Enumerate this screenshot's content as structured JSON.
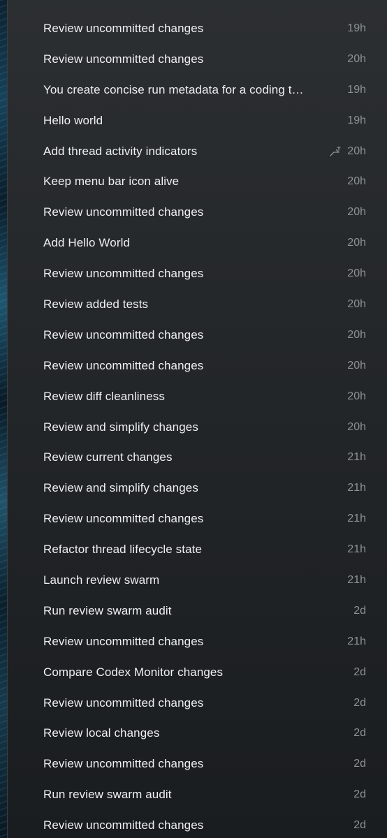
{
  "threads": [
    {
      "title": "Review uncommitted changes",
      "age": "19h",
      "activity_icon": false
    },
    {
      "title": "Review uncommitted changes",
      "age": "20h",
      "activity_icon": false
    },
    {
      "title": "You create concise run metadata for a coding t…",
      "age": "19h",
      "activity_icon": false
    },
    {
      "title": "Hello world",
      "age": "19h",
      "activity_icon": false
    },
    {
      "title": "Add thread activity indicators",
      "age": "20h",
      "activity_icon": true,
      "icon": "branch-merge-icon"
    },
    {
      "title": "Keep menu bar icon alive",
      "age": "20h",
      "activity_icon": false
    },
    {
      "title": "Review uncommitted changes",
      "age": "20h",
      "activity_icon": false
    },
    {
      "title": "Add Hello World",
      "age": "20h",
      "activity_icon": false
    },
    {
      "title": "Review uncommitted changes",
      "age": "20h",
      "activity_icon": false
    },
    {
      "title": "Review added tests",
      "age": "20h",
      "activity_icon": false
    },
    {
      "title": "Review uncommitted changes",
      "age": "20h",
      "activity_icon": false
    },
    {
      "title": "Review uncommitted changes",
      "age": "20h",
      "activity_icon": false
    },
    {
      "title": "Review diff cleanliness",
      "age": "20h",
      "activity_icon": false
    },
    {
      "title": "Review and simplify changes",
      "age": "20h",
      "activity_icon": false
    },
    {
      "title": "Review current changes",
      "age": "21h",
      "activity_icon": false
    },
    {
      "title": "Review and simplify changes",
      "age": "21h",
      "activity_icon": false
    },
    {
      "title": "Review uncommitted changes",
      "age": "21h",
      "activity_icon": false
    },
    {
      "title": "Refactor thread lifecycle state",
      "age": "21h",
      "activity_icon": false
    },
    {
      "title": "Launch review swarm",
      "age": "21h",
      "activity_icon": false
    },
    {
      "title": "Run review swarm audit",
      "age": "2d",
      "activity_icon": false
    },
    {
      "title": "Review uncommitted changes",
      "age": "21h",
      "activity_icon": false
    },
    {
      "title": "Compare Codex Monitor changes",
      "age": "2d",
      "activity_icon": false
    },
    {
      "title": "Review uncommitted changes",
      "age": "2d",
      "activity_icon": false
    },
    {
      "title": "Review local changes",
      "age": "2d",
      "activity_icon": false
    },
    {
      "title": "Review uncommitted changes",
      "age": "2d",
      "activity_icon": false
    },
    {
      "title": "Run review swarm audit",
      "age": "2d",
      "activity_icon": false
    },
    {
      "title": "Review uncommitted changes",
      "age": "2d",
      "activity_icon": false
    }
  ],
  "colors": {
    "sidebar_bg": "#26292c",
    "title_text": "#eef0f2",
    "age_text": "#8e9296",
    "icon": "#8e9296"
  }
}
